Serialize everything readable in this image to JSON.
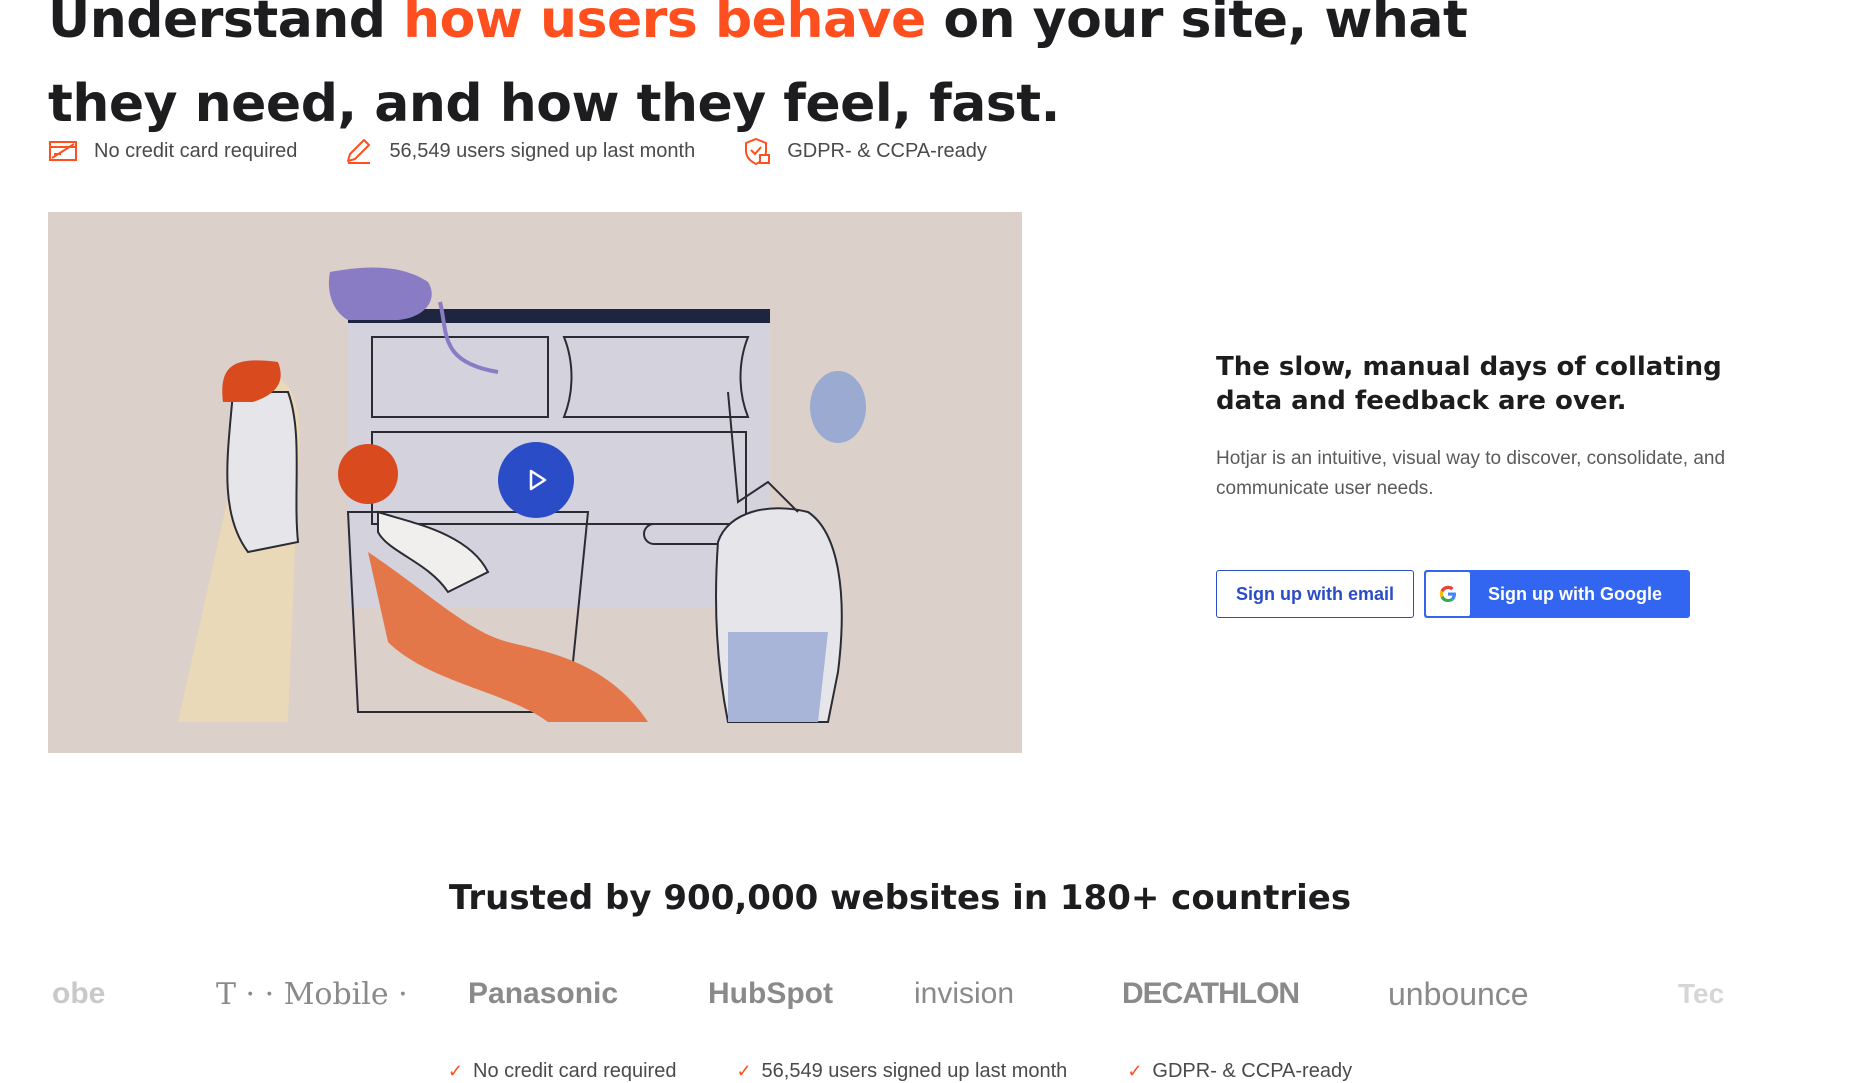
{
  "hero": {
    "title_part1": "Understand ",
    "title_accent": "how users behave",
    "title_part2": " on your site, what they need, and how they feel, fast.",
    "accent_color": "#ff4f1e"
  },
  "badges": [
    {
      "icon": "credit-card-icon",
      "label": "No credit card required"
    },
    {
      "icon": "pencil-icon",
      "label": "56,549 users signed up last month"
    },
    {
      "icon": "shield-lock-icon",
      "label": "GDPR- & CCPA-ready"
    }
  ],
  "video": {
    "play_icon": "play-icon"
  },
  "side": {
    "heading": "The slow, manual days of collating data and feedback are over.",
    "body": "Hotjar is an intuitive, visual way to discover, consolidate, and communicate user needs.",
    "btn_email": "Sign up with email",
    "btn_google": "Sign up with Google",
    "brand_color": "#3366f0"
  },
  "trusted": {
    "heading": "Trusted by 900,000 websites in 180+ countries",
    "logos": [
      "obe",
      "T · · Mobile ·",
      "Panasonic",
      "HubSpot",
      "invision",
      "DECATHLON",
      "unbounce",
      "Tec"
    ]
  },
  "bottom_badges": [
    {
      "icon": "check-icon",
      "label": "No credit card required"
    },
    {
      "icon": "check-icon",
      "label": "56,549 users signed up last month"
    },
    {
      "icon": "check-icon",
      "label": "GDPR- & CCPA-ready"
    }
  ]
}
